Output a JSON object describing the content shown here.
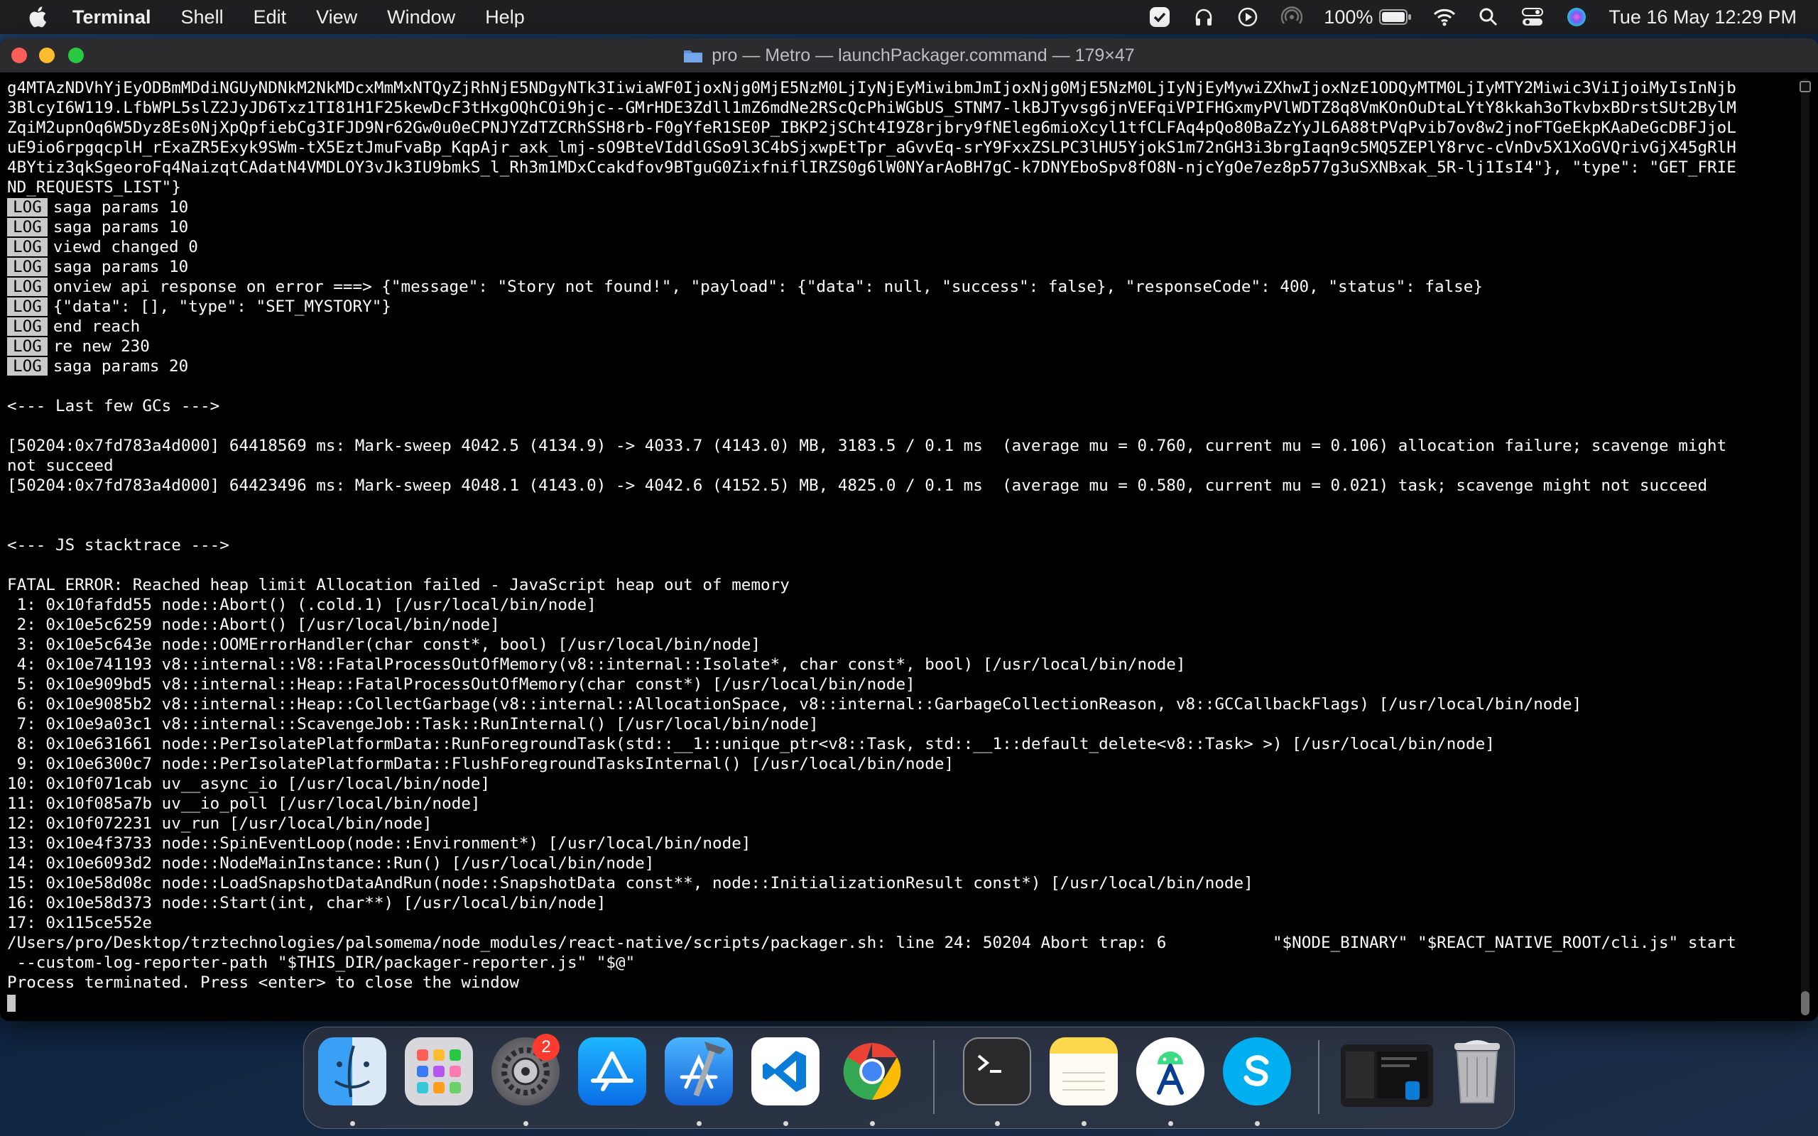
{
  "menubar": {
    "app": "Terminal",
    "items": [
      "Shell",
      "Edit",
      "View",
      "Window",
      "Help"
    ],
    "battery": "100%",
    "datetime": "Tue 16 May  12:29 PM"
  },
  "window": {
    "title": "pro — Metro — launchPackager.command — 179×47"
  },
  "terminal": {
    "lines": [
      {
        "text": "g4MTAzNDVhYjEyODBmMDdiNGUyNDNkM2NkMDcxMmMxNTQyZjRhNjE5NDgyNTk3IiwiaWF0IjoxNjg0MjE5NzM0LjIyNjEyMiwibmJmIjoxNjg0MjE5NzM0LjIyNjEyMywiZXhwIjoxNzE1ODQyMTM0LjIyMTY2Miwic3ViIjoiMyIsInNjb"
      },
      {
        "text": "3BlcyI6W119.LfbWPL5slZ2JyJD6Txz1TI81H1F25kewDcF3tHxgOQhCOi9hjc--GMrHDE3Zdll1mZ6mdNe2RScQcPhiWGbUS_STNM7-lkBJTyvsg6jnVEFqiVPIFHGxmyPVlWDTZ8q8VmKOnOuDtaLYtY8kkah3oTkvbxBDrstSUt2BylM"
      },
      {
        "text": "ZqiM2upnOq6W5Dyz8Es0NjXpQpfiebCg3IFJD9Nr62Gw0u0eCPNJYZdTZCRhSSH8rb-F0gYfeR1SE0P_IBKP2jSCht4I9Z8rjbry9fNEleg6mioXcyl1tfCLFAq4pQo80BaZzYyJL6A88tPVqPvib7ov8w2jnoFTGeEkpKAaDeGcDBFJjoL"
      },
      {
        "text": "uE9io6rpgqcplH_rExaZR5Exyk9SWm-tX5EztJmuFvaBp_KqpAjr_axk_lmj-sO9BteVIddlGSo9l3C4bSjxwpEtTpr_aGvvEq-srY9FxxZSLPC3lHU5YjokS1m72nGH3i3brgIaqn9c5MQ5ZEPlY8rvc-cVnDv5X1XoGVQrivGjX45gRlH"
      },
      {
        "text": "4BYtiz3qkSgeoroFq4NaizqtCAdatN4VMDLOY3vJk3IU9bmkS_l_Rh3m1MDxCcakdfov9BTguG0ZixfniflIRZS0g6lW0NYarAoBH7gC-k7DNYEboSpv8fO8N-njcYgOe7ez8p577g3uSXNBxak_5R-lj1IsI4\"}, \"type\": \"GET_FRIE"
      },
      {
        "text": "ND_REQUESTS_LIST\"}"
      },
      {
        "badge": "LOG",
        "text": "saga params 10"
      },
      {
        "badge": "LOG",
        "text": "saga params 10"
      },
      {
        "badge": "LOG",
        "text": "viewd changed 0"
      },
      {
        "badge": "LOG",
        "text": "saga params 10"
      },
      {
        "badge": "LOG",
        "text": "onview api response on error ===> {\"message\": \"Story not found!\", \"payload\": {\"data\": null, \"success\": false}, \"responseCode\": 400, \"status\": false}"
      },
      {
        "badge": "LOG",
        "text": "{\"data\": [], \"type\": \"SET_MYSTORY\"}"
      },
      {
        "badge": "LOG",
        "text": "end reach"
      },
      {
        "badge": "LOG",
        "text": "re new 230"
      },
      {
        "badge": "LOG",
        "text": "saga params 20"
      },
      {
        "text": ""
      },
      {
        "text": "<--- Last few GCs --->"
      },
      {
        "text": ""
      },
      {
        "text": "[50204:0x7fd783a4d000] 64418569 ms: Mark-sweep 4042.5 (4134.9) -> 4033.7 (4143.0) MB, 3183.5 / 0.1 ms  (average mu = 0.760, current mu = 0.106) allocation failure; scavenge might"
      },
      {
        "text": "not succeed"
      },
      {
        "text": "[50204:0x7fd783a4d000] 64423496 ms: Mark-sweep 4048.1 (4143.0) -> 4042.6 (4152.5) MB, 4825.0 / 0.1 ms  (average mu = 0.580, current mu = 0.021) task; scavenge might not succeed"
      },
      {
        "text": ""
      },
      {
        "text": ""
      },
      {
        "text": "<--- JS stacktrace --->"
      },
      {
        "text": ""
      },
      {
        "text": "FATAL ERROR: Reached heap limit Allocation failed - JavaScript heap out of memory"
      },
      {
        "text": " 1: 0x10fafdd55 node::Abort() (.cold.1) [/usr/local/bin/node]"
      },
      {
        "text": " 2: 0x10e5c6259 node::Abort() [/usr/local/bin/node]"
      },
      {
        "text": " 3: 0x10e5c643e node::OOMErrorHandler(char const*, bool) [/usr/local/bin/node]"
      },
      {
        "text": " 4: 0x10e741193 v8::internal::V8::FatalProcessOutOfMemory(v8::internal::Isolate*, char const*, bool) [/usr/local/bin/node]"
      },
      {
        "text": " 5: 0x10e909bd5 v8::internal::Heap::FatalProcessOutOfMemory(char const*) [/usr/local/bin/node]"
      },
      {
        "text": " 6: 0x10e9085b2 v8::internal::Heap::CollectGarbage(v8::internal::AllocationSpace, v8::internal::GarbageCollectionReason, v8::GCCallbackFlags) [/usr/local/bin/node]"
      },
      {
        "text": " 7: 0x10e9a03c1 v8::internal::ScavengeJob::Task::RunInternal() [/usr/local/bin/node]"
      },
      {
        "text": " 8: 0x10e631661 node::PerIsolatePlatformData::RunForegroundTask(std::__1::unique_ptr<v8::Task, std::__1::default_delete<v8::Task> >) [/usr/local/bin/node]"
      },
      {
        "text": " 9: 0x10e6300c7 node::PerIsolatePlatformData::FlushForegroundTasksInternal() [/usr/local/bin/node]"
      },
      {
        "text": "10: 0x10f071cab uv__async_io [/usr/local/bin/node]"
      },
      {
        "text": "11: 0x10f085a7b uv__io_poll [/usr/local/bin/node]"
      },
      {
        "text": "12: 0x10f072231 uv_run [/usr/local/bin/node]"
      },
      {
        "text": "13: 0x10e4f3733 node::SpinEventLoop(node::Environment*) [/usr/local/bin/node]"
      },
      {
        "text": "14: 0x10e6093d2 node::NodeMainInstance::Run() [/usr/local/bin/node]"
      },
      {
        "text": "15: 0x10e58d08c node::LoadSnapshotDataAndRun(node::SnapshotData const**, node::InitializationResult const*) [/usr/local/bin/node]"
      },
      {
        "text": "16: 0x10e58d373 node::Start(int, char**) [/usr/local/bin/node]"
      },
      {
        "text": "17: 0x115ce552e"
      },
      {
        "text": "/Users/pro/Desktop/trztechnologies/palsomema/node_modules/react-native/scripts/packager.sh: line 24: 50204 Abort trap: 6           \"$NODE_BINARY\" \"$REACT_NATIVE_ROOT/cli.js\" start"
      },
      {
        "text": " --custom-log-reporter-path \"$THIS_DIR/packager-reporter.js\" \"$@\""
      },
      {
        "text": "Process terminated. Press <enter> to close the window"
      }
    ]
  },
  "dock": {
    "settings_badge": "2",
    "apps": [
      "finder",
      "launchpad",
      "system-settings",
      "app-store",
      "xcode",
      "vscode",
      "chrome",
      "terminal",
      "notes",
      "android-studio",
      "skype",
      "window-preview",
      "trash"
    ]
  }
}
